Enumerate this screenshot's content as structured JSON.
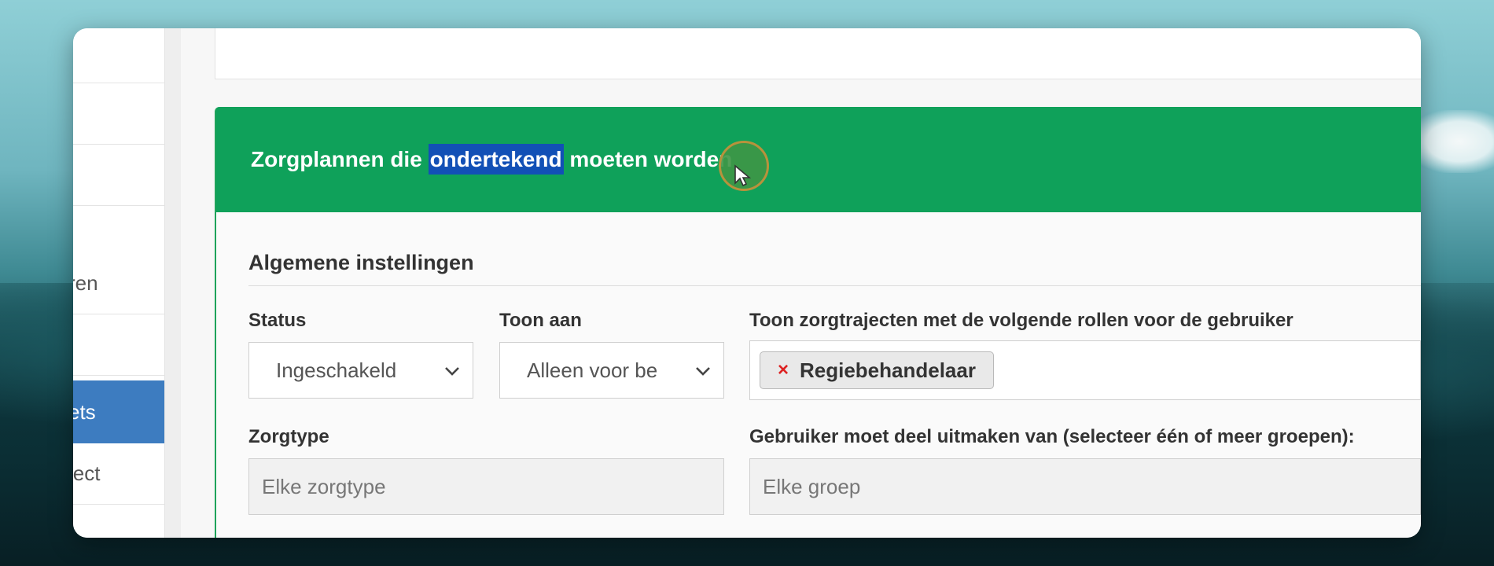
{
  "sidebar": {
    "items": [
      {
        "label": ""
      },
      {
        "label": ""
      },
      {
        "label": ""
      },
      {
        "label": "ren"
      },
      {
        "label": ""
      },
      {
        "label": "ets"
      },
      {
        "label": "ject"
      }
    ],
    "active_index": 5
  },
  "card": {
    "title_before": "Zorgplannen die ",
    "title_highlight": "ondertekend",
    "title_after": " moeten worden"
  },
  "section": {
    "title": "Algemene instellingen"
  },
  "fields": {
    "status": {
      "label": "Status",
      "value": "Ingeschakeld"
    },
    "toon_aan": {
      "label": "Toon aan",
      "value": "Alleen voor be"
    },
    "rollen": {
      "label": "Toon zorgtrajecten met de volgende rollen voor de gebruiker",
      "tags": [
        "Regiebehandelaar"
      ]
    },
    "zorgtype": {
      "label": "Zorgtype",
      "placeholder": "Elke zorgtype"
    },
    "groepen": {
      "label": "Gebruiker moet deel uitmaken van (selecteer één of meer groepen):",
      "placeholder": "Elke groep"
    }
  },
  "colors": {
    "header_green": "#0fa15a",
    "sidebar_active": "#3d7cc0",
    "highlight": "#1250b6",
    "tag_remove": "#dd2222"
  },
  "icons": {
    "chevron": "chevron-down-icon",
    "remove": "remove-tag-icon",
    "cursor": "mouse-pointer-icon"
  }
}
